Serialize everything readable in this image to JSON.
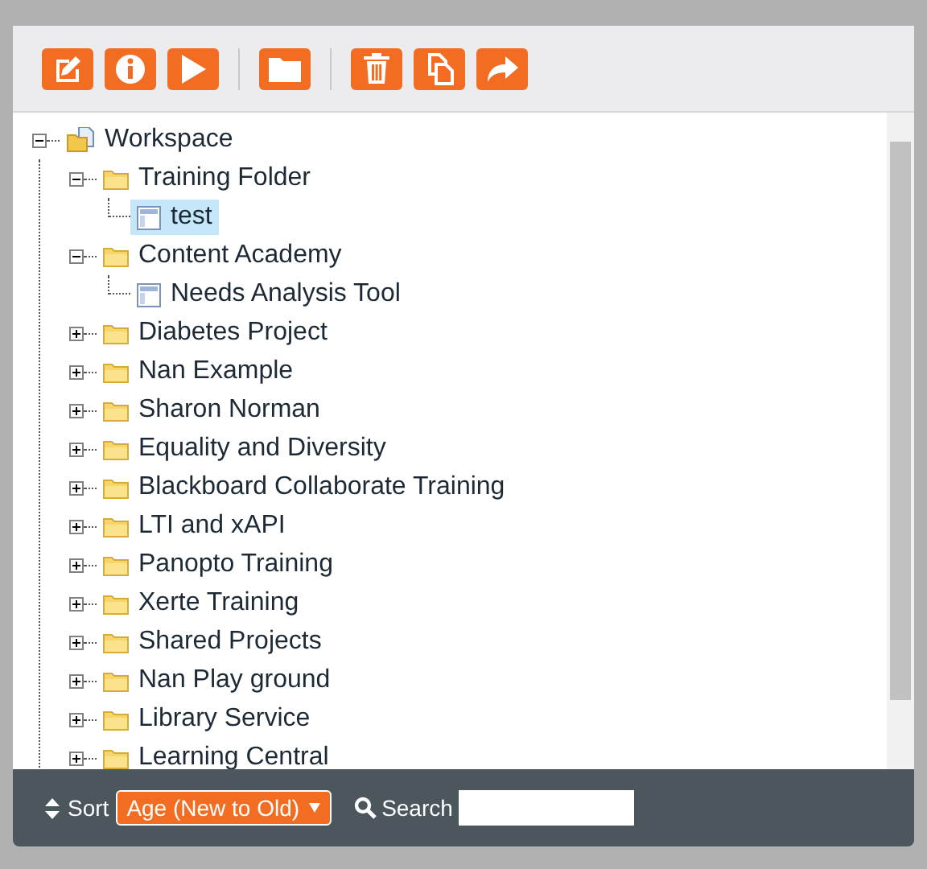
{
  "toolbar": [
    {
      "kind": "edit"
    },
    {
      "kind": "info"
    },
    {
      "kind": "play"
    },
    {
      "kind": "separator"
    },
    {
      "kind": "folder"
    },
    {
      "kind": "separator"
    },
    {
      "kind": "delete"
    },
    {
      "kind": "copy"
    },
    {
      "kind": "share"
    }
  ],
  "tree": {
    "label": "Workspace",
    "kind": "workspace",
    "expanded": true,
    "selected": false,
    "children": [
      {
        "label": "Training Folder",
        "kind": "folder",
        "expanded": true,
        "selected": false,
        "children": [
          {
            "label": "test",
            "kind": "page",
            "selected": true
          }
        ]
      },
      {
        "label": "Content Academy",
        "kind": "folder",
        "expanded": true,
        "selected": false,
        "children": [
          {
            "label": "Needs Analysis Tool",
            "kind": "page",
            "selected": false
          }
        ]
      },
      {
        "label": "Diabetes Project",
        "kind": "folder",
        "expanded": false,
        "selected": false
      },
      {
        "label": "Nan Example",
        "kind": "folder",
        "expanded": false,
        "selected": false
      },
      {
        "label": "Sharon Norman",
        "kind": "folder",
        "expanded": false,
        "selected": false
      },
      {
        "label": "Equality and Diversity",
        "kind": "folder",
        "expanded": false,
        "selected": false
      },
      {
        "label": "Blackboard Collaborate Training",
        "kind": "folder",
        "expanded": false,
        "selected": false
      },
      {
        "label": "LTI and xAPI",
        "kind": "folder",
        "expanded": false,
        "selected": false
      },
      {
        "label": "Panopto Training",
        "kind": "folder",
        "expanded": false,
        "selected": false
      },
      {
        "label": "Xerte Training",
        "kind": "folder",
        "expanded": false,
        "selected": false
      },
      {
        "label": "Shared Projects",
        "kind": "folder",
        "expanded": false,
        "selected": false
      },
      {
        "label": "Nan Play ground",
        "kind": "folder",
        "expanded": false,
        "selected": false
      },
      {
        "label": "Library Service",
        "kind": "folder",
        "expanded": false,
        "selected": false
      },
      {
        "label": "Learning Central",
        "kind": "folder",
        "expanded": false,
        "selected": false
      }
    ]
  },
  "footer": {
    "sort_label": "Sort",
    "sort_value": "Age (New to Old)",
    "search_label": "Search"
  }
}
